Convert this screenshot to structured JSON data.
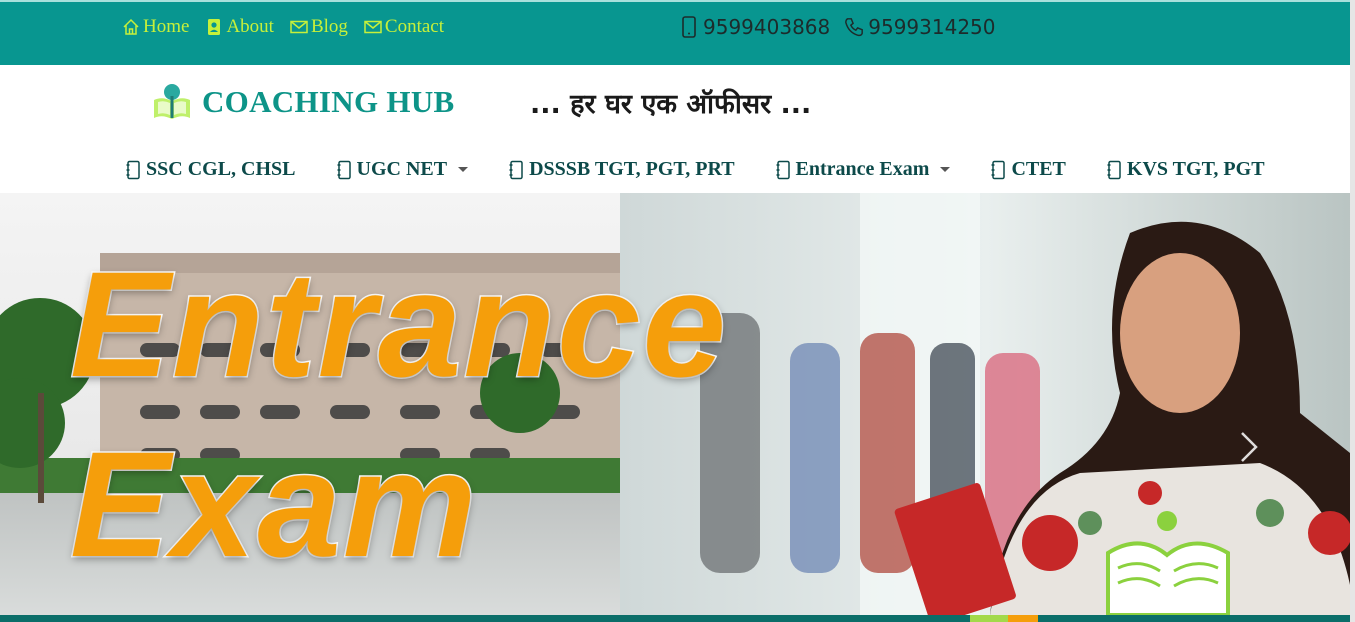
{
  "topbar": {
    "links": [
      {
        "label": "Home",
        "icon": "home-icon"
      },
      {
        "label": "About",
        "icon": "user-card-icon"
      },
      {
        "label": "Blog",
        "icon": "envelope-icon"
      },
      {
        "label": "Contact",
        "icon": "envelope-icon"
      }
    ],
    "phones": [
      {
        "number": "9599403868",
        "icon": "mobile-phone-icon"
      },
      {
        "number": "9599314250",
        "icon": "telephone-icon"
      }
    ]
  },
  "brand": {
    "name": "COACHING HUB",
    "tagline": "... हर घर एक ऑफीसर ..."
  },
  "nav": {
    "items": [
      {
        "label": "SSC CGL, CHSL",
        "dropdown": false
      },
      {
        "label": "UGC NET",
        "dropdown": true
      },
      {
        "label": "DSSSB TGT, PGT, PRT",
        "dropdown": false
      },
      {
        "label": "Entrance Exam",
        "dropdown": true
      },
      {
        "label": "CTET",
        "dropdown": false
      },
      {
        "label": "KVS TGT, PGT",
        "dropdown": false
      }
    ]
  },
  "hero": {
    "line1": "Entrance",
    "line2": "Exam"
  },
  "colors": {
    "topbar": "#089690",
    "link": "#c6f03a",
    "brand": "#0d9488",
    "accent_orange": "#f59e0b"
  }
}
